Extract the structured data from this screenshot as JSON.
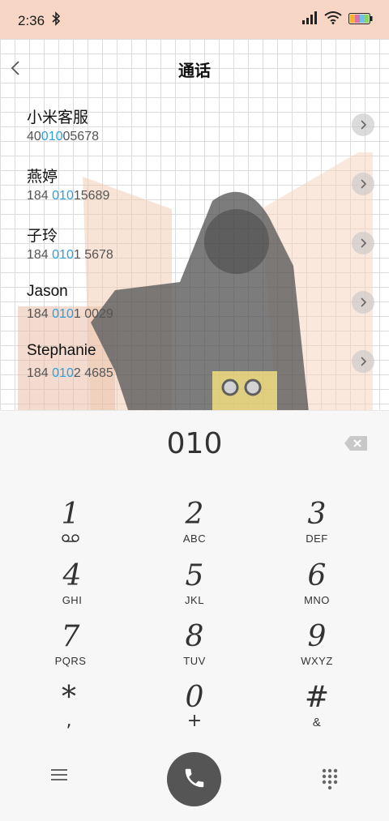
{
  "status": {
    "time": "2:36"
  },
  "header": {
    "title": "通话"
  },
  "contacts": [
    {
      "name": "小米客服",
      "num_pre": "40",
      "num_hl": "010",
      "num_post": "05678"
    },
    {
      "name": "燕婷",
      "num_pre": "184 ",
      "num_hl": "010",
      "num_post": "15689"
    },
    {
      "name": "子玲",
      "num_pre": "184 ",
      "num_hl": "010",
      "num_post": "1 5678"
    },
    {
      "name": "Jason",
      "num_pre": "184 ",
      "num_hl": "010",
      "num_post": "1 0029"
    },
    {
      "name": "Stephanie",
      "num_pre": "184 ",
      "num_hl": "010",
      "num_post": "2 4685"
    }
  ],
  "dialer": {
    "entered_number": "010",
    "keys": [
      {
        "digit": "1",
        "letters": ""
      },
      {
        "digit": "2",
        "letters": "ABC"
      },
      {
        "digit": "3",
        "letters": "DEF"
      },
      {
        "digit": "4",
        "letters": "GHI"
      },
      {
        "digit": "5",
        "letters": "JKL"
      },
      {
        "digit": "6",
        "letters": "MNO"
      },
      {
        "digit": "7",
        "letters": "PQRS"
      },
      {
        "digit": "8",
        "letters": "TUV"
      },
      {
        "digit": "9",
        "letters": "WXYZ"
      },
      {
        "digit": "*",
        "letters": ","
      },
      {
        "digit": "0",
        "letters": "+"
      },
      {
        "digit": "#",
        "letters": "&"
      }
    ]
  },
  "icons": {
    "back": "chevron-left-icon",
    "voicemail": "voicemail-icon",
    "backspace": "backspace-icon",
    "menu": "menu-icon",
    "call": "phone-icon",
    "dialpad": "dialpad-icon"
  },
  "colors": {
    "status_bar": "#f7d6c6",
    "highlight": "#2d9ee0",
    "call_button": "#555555"
  }
}
